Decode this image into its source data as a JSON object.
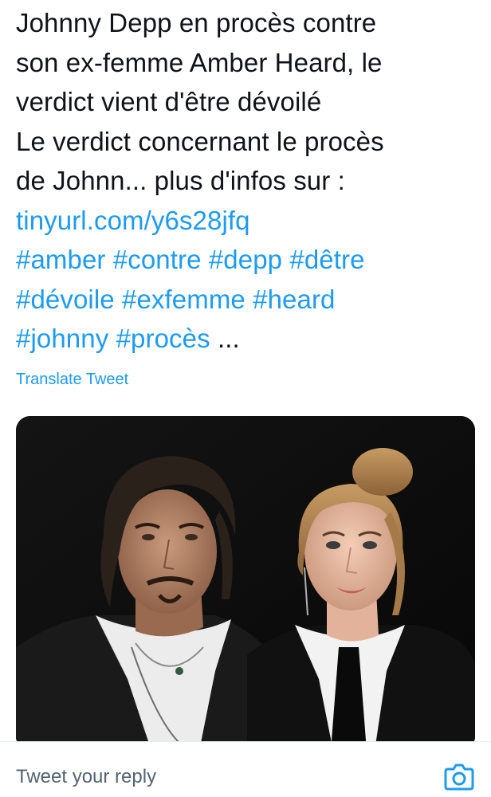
{
  "tweet": {
    "text_lines": [
      "Johnny Depp en procès contre",
      "son ex-femme Amber Heard, le",
      "verdict vient d'être dévoilé",
      "Le verdict concernant le procès",
      "de Johnn... plus d'infos sur :"
    ],
    "link": "tinyurl.com/y6s28jfq",
    "hashtags_line1": [
      "#amber",
      "#contre",
      "#depp",
      "#dêtre"
    ],
    "hashtags_line2": [
      "#dévoile",
      "#exfemme",
      "#heard"
    ],
    "hashtags_line3": [
      "#johnny",
      "#procès"
    ],
    "ellipsis": "...",
    "translate_label": "Translate Tweet"
  },
  "reply": {
    "placeholder": "Tweet your reply"
  },
  "icons": {
    "camera": "camera-icon"
  },
  "colors": {
    "link": "#1d9bf0",
    "text": "#0f1419",
    "placeholder": "#536471"
  }
}
